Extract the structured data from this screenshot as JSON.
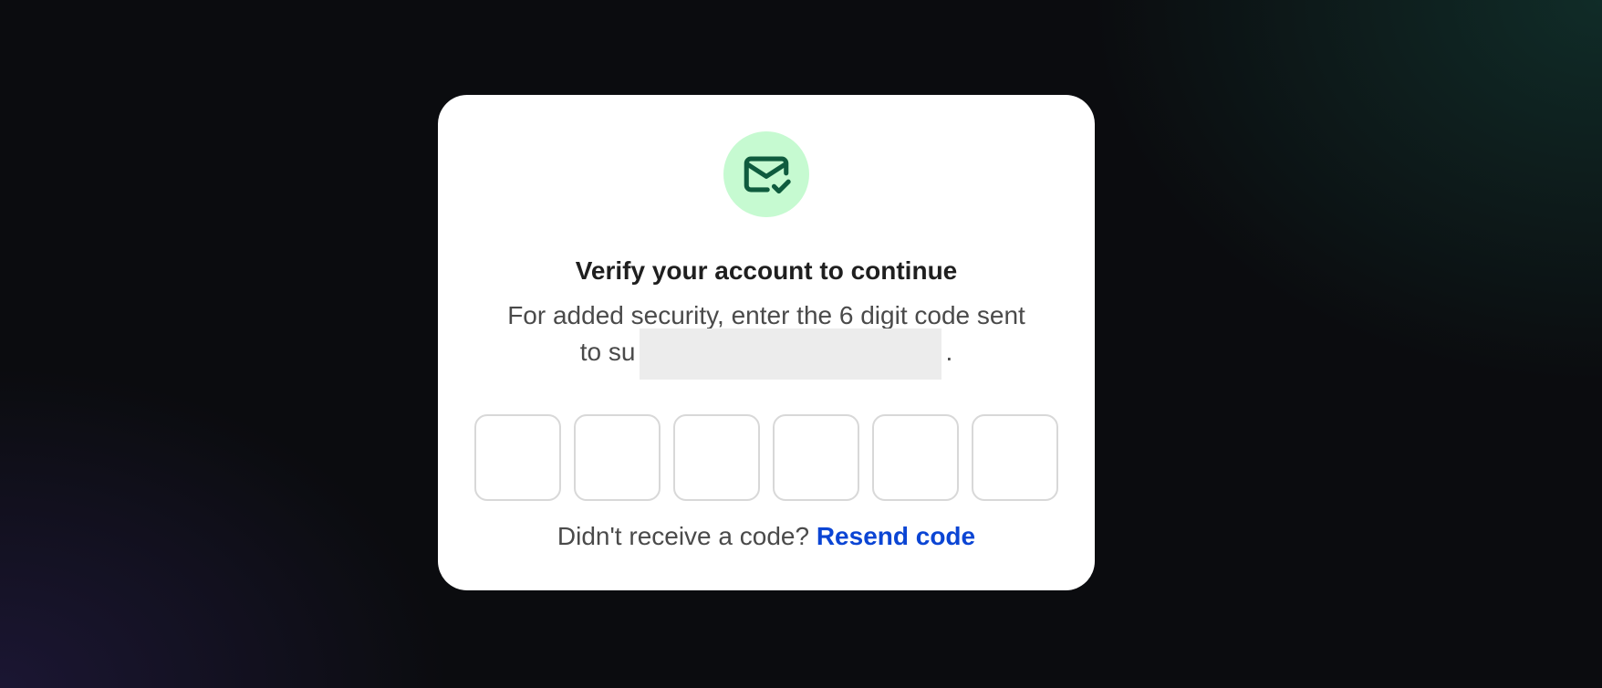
{
  "modal": {
    "icon": "mail-check-icon",
    "title": "Verify your account to continue",
    "description_line1": "For added security, enter the 6 digit code sent",
    "description_line2_prefix": "to su",
    "description_line2_suffix": ".",
    "otp": {
      "digits": [
        {
          "value": ""
        },
        {
          "value": ""
        },
        {
          "value": ""
        },
        {
          "value": ""
        },
        {
          "value": ""
        },
        {
          "value": ""
        }
      ]
    },
    "resend_prompt": "Didn't receive a code?",
    "resend_link": "Resend code"
  },
  "colors": {
    "badge_bg": "#c6fad1",
    "icon": "#0f5b3e",
    "link": "#0b45d4",
    "redaction": "#ececec"
  }
}
